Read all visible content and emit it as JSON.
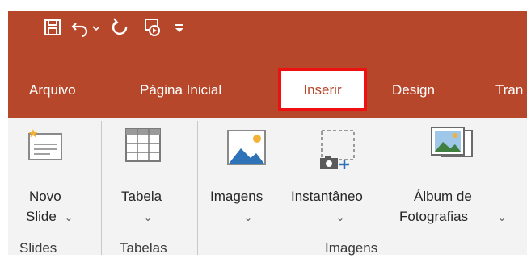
{
  "quick_access": {
    "icons": [
      "save-icon",
      "undo-icon",
      "undo-dropdown-icon",
      "redo-icon",
      "present-from-beginning-icon",
      "customize-qat-icon"
    ]
  },
  "tabs": [
    "Arquivo",
    "Página Inicial",
    "Inserir",
    "Design",
    "Tran"
  ],
  "active_tab": "Inserir",
  "colors": {
    "accent": "#b7472a",
    "highlight_border": "#ee1111",
    "ribbon_bg": "#f3f3f3"
  },
  "ribbon": {
    "novo_slide": {
      "line1": "Novo",
      "line2": "Slide",
      "chevron": "⌄"
    },
    "tabela": {
      "line1": "Tabela",
      "chevron": "⌄"
    },
    "imagens": {
      "line1": "Imagens",
      "chevron": "⌄"
    },
    "instantaneo": {
      "line1": "Instantâneo",
      "chevron": "⌄"
    },
    "album": {
      "line1": "Álbum de",
      "line2": "Fotografias",
      "chevron": "⌄"
    },
    "groups": {
      "slides": "Slides",
      "tabelas": "Tabelas",
      "imagens": "Imagens"
    }
  }
}
